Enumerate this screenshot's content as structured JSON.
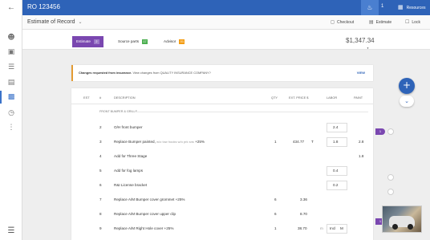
{
  "topbar": {
    "ro_title": "RO 123456",
    "notification_count": "1",
    "resources_label": "Resources"
  },
  "subheader": {
    "title": "Estimate of Record",
    "checkout_label": "Checkout",
    "estimate_label": "Estimate",
    "lock_label": "Lock"
  },
  "tabs": [
    {
      "label": "Estimate",
      "badge": "2",
      "badge_color": "#9c79c8"
    },
    {
      "label": "Source parts",
      "badge": "17",
      "badge_color": "#4caf50"
    },
    {
      "label": "Advisor",
      "badge": "01",
      "badge_color": "#f39c12"
    }
  ],
  "total": "$1,347.34",
  "notice": {
    "bold": "Changes requested from insurance.",
    "text": "View changes from QUALITY INSURANCE COMPANY?",
    "action": "VIEW"
  },
  "table": {
    "headers": {
      "est": "EST",
      "num": "#",
      "description": "DESCRIPTION",
      "qty": "QTY",
      "ext_price": "EXT. PRICE $",
      "labor": "LABOR",
      "paint": "PAINT"
    },
    "section": "FRONT BUMPER & GRILLE",
    "rows": [
      {
        "num": "2",
        "desc": "O/H front bumper",
        "note": "",
        "qty": "",
        "price": "",
        "price_flag": "",
        "labor_prefix": "",
        "labor": "2.4",
        "labor_flag": "",
        "paint": ""
      },
      {
        "num": "3",
        "desc": "Replace Bumper painted,",
        "note": "w/o tow hooks w/o prk sns",
        "suffix": "+25%",
        "qty": "1",
        "price": "434.77",
        "price_flag": "T",
        "labor_prefix": "",
        "labor": "1.8",
        "labor_flag": "",
        "paint": "2.8"
      },
      {
        "num": "4",
        "desc": "Add for Three Stage",
        "note": "",
        "qty": "",
        "price": "",
        "price_flag": "",
        "labor_prefix": "",
        "labor": "",
        "labor_flag": "",
        "paint": "1.8"
      },
      {
        "num": "5",
        "desc": "Add for fog lamps",
        "note": "",
        "qty": "",
        "price": "",
        "price_flag": "",
        "labor_prefix": "",
        "labor": "0.4",
        "labor_flag": "",
        "paint": ""
      },
      {
        "num": "6",
        "desc": "R&I License bracket",
        "note": "",
        "qty": "",
        "price": "",
        "price_flag": "",
        "labor_prefix": "",
        "labor": "0.2",
        "labor_flag": "",
        "paint": ""
      },
      {
        "num": "7",
        "desc": "Replace A/M Bumper cover grommet +25%",
        "note": "",
        "qty": "6",
        "price": "3.36",
        "price_flag": "",
        "labor_prefix": "",
        "labor": "",
        "labor_flag": "",
        "paint": ""
      },
      {
        "num": "8",
        "desc": "Replace A/M Bumper cover upper clip",
        "note": "",
        "qty": "6",
        "price": "8.70",
        "price_flag": "",
        "labor_prefix": "",
        "labor": "",
        "labor_flag": "",
        "paint": ""
      },
      {
        "num": "9",
        "desc": "Replace A/M Right Hole cover +25%",
        "note": "",
        "qty": "1",
        "price": "38.70",
        "price_flag": "",
        "labor_prefix": "m",
        "labor": "Incl",
        "labor_flag": "M",
        "paint": ""
      }
    ]
  },
  "right_controls": {
    "tag_1": "1",
    "tag_2": "1"
  },
  "icons": {
    "back": "back-arrow-icon",
    "bell": "bell-icon",
    "resources": "book-icon",
    "checkout": "cart-icon",
    "estimate": "document-icon",
    "lock": "lock-icon",
    "menu": "hamburger-menu-icon",
    "add": "plus-icon",
    "expand": "chevron-down-icon"
  },
  "colors": {
    "primary": "#2e63b8",
    "tab_active": "#7a47b0",
    "notice_accent": "#e39b33"
  }
}
